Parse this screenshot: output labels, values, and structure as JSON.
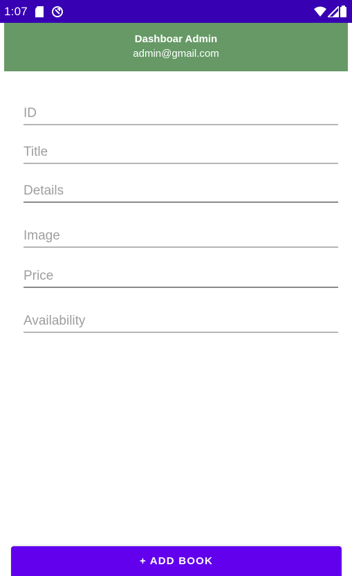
{
  "status_bar": {
    "time": "1:07",
    "left_icons": [
      "sd-card-icon",
      "sync-icon"
    ],
    "right_icons": [
      "wifi-icon",
      "signal-icon",
      "battery-icon"
    ]
  },
  "header": {
    "title": "Dashboar Admin",
    "email": "admin@gmail.com",
    "background": "#669966"
  },
  "form": {
    "fields": [
      {
        "placeholder": "ID",
        "value": ""
      },
      {
        "placeholder": "Title",
        "value": ""
      },
      {
        "placeholder": "Details",
        "value": ""
      },
      {
        "placeholder": "Image",
        "value": ""
      },
      {
        "placeholder": "Price",
        "value": ""
      },
      {
        "placeholder": "Availability",
        "value": ""
      }
    ]
  },
  "add_button": {
    "label": "+ ADD BOOK",
    "background": "#6200ee"
  },
  "colors": {
    "status_bar": "#3700b3",
    "header": "#669966",
    "accent": "#6200ee"
  }
}
